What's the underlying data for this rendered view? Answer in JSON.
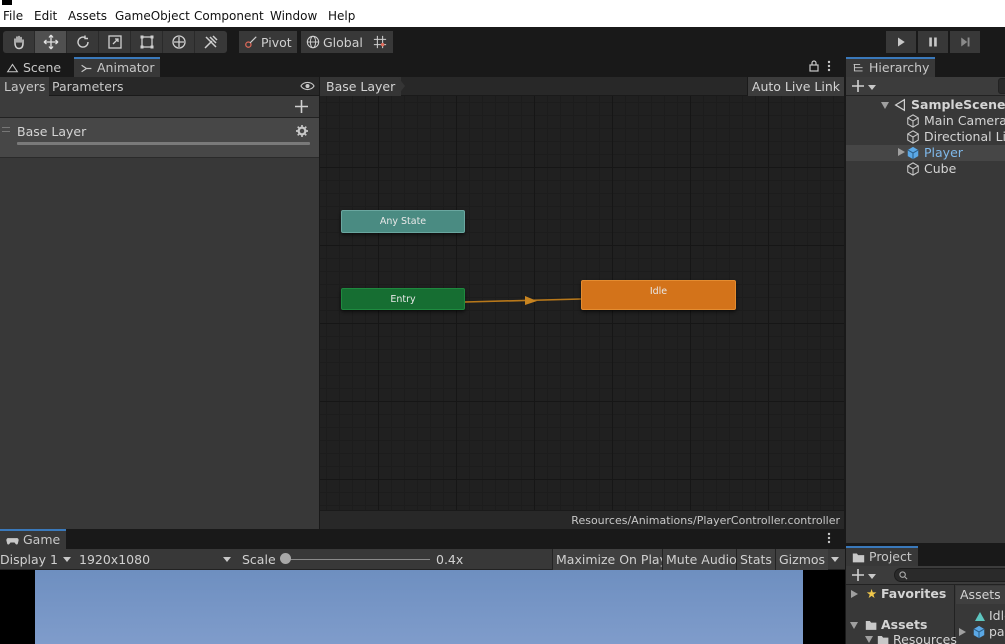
{
  "menu": [
    "File",
    "Edit",
    "Assets",
    "GameObject",
    "Component",
    "Window",
    "Help"
  ],
  "toolbar": {
    "pivot_label": "Pivot",
    "global_label": "Global"
  },
  "tabs": {
    "scene": "Scene",
    "animator": "Animator",
    "hierarchy": "Hierarchy",
    "game": "Game",
    "project": "Project"
  },
  "animator": {
    "layers_tab": "Layers",
    "parameters_tab": "Parameters",
    "layer_name": "Base Layer",
    "breadcrumb": "Base Layer",
    "auto_live_link": "Auto Live Link",
    "nodes": {
      "any_state": "Any State",
      "entry": "Entry",
      "idle": "Idle"
    },
    "controller_path": "Resources/Animations/PlayerController.controller"
  },
  "hierarchy": {
    "scene": "SampleScene*",
    "items": [
      "Main Camera",
      "Directional Light",
      "Player",
      "Cube"
    ]
  },
  "game": {
    "display": "Display 1",
    "resolution": "1920x1080",
    "scale_label": "Scale",
    "scale_value": "0.4x",
    "maximize": "Maximize On Play",
    "mute": "Mute Audio",
    "stats": "Stats",
    "gizmos": "Gizmos"
  },
  "project": {
    "favorites": "Favorites",
    "assets": "Assets",
    "resources": "Resources",
    "breadcrumb": "Assets",
    "file1": "Idle",
    "file2": "pa"
  },
  "colors": {
    "any_state": "#4a8b82",
    "entry": "#166e32",
    "idle": "#d3731a",
    "tab_accent": "#3a79bb"
  }
}
